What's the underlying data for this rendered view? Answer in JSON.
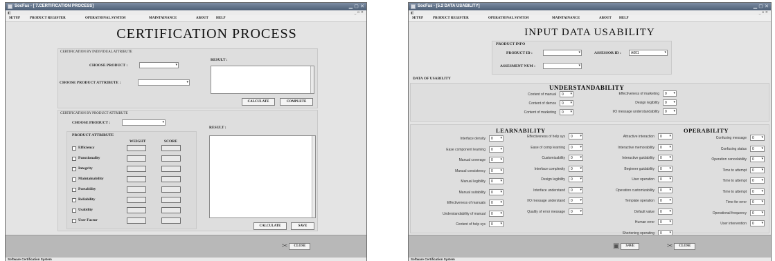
{
  "win1": {
    "title": "SocFas - [ 7.CERTIFICATION PROCESS]",
    "menu": [
      "SETUP",
      "PRODUCT REGISTER",
      "OPERATIONAL SYSTEM",
      "MAINTAINANCE",
      "ABOUT",
      "HELP"
    ],
    "page_title": "CERTIFICATION PROCESS",
    "individual": {
      "header": "CERTIFICATION BY INDIVIDUAL ATTRIBUTE",
      "choose_product_label": "CHOOSE PRODUCT :",
      "choose_attribute_label": "CHOOSE PRODUCT ATTRIBUTE :",
      "result_label": "RESULT :",
      "calculate": "CALCULATE",
      "complete": "COMPLETE"
    },
    "byproduct": {
      "header": "CERTIFICATION BY PRODUCT ATTRIBUTE",
      "choose_product_label": "CHOOSE PRODUCT :",
      "attr_group_label": "PRODUCT ATTRIBUTE",
      "weight_col": "WEIGHT",
      "score_col": "SCORE",
      "attributes": [
        "Efficiency",
        "Functionality",
        "Integrity",
        "Maintainability",
        "Portability",
        "Reliability",
        "Usability",
        "User Factor"
      ],
      "result_label": "RESULT :",
      "calculate": "CALCULATE",
      "save": "SAVE"
    },
    "close": "CLOSE",
    "status": "Software Certification System"
  },
  "win2": {
    "title": "SocFas - [5.2 DATA USABILITY]",
    "menu": [
      "SETUP",
      "PRODUCT REGISTER",
      "OPERATIONAL SYSTEM",
      "MAINTAINANCE",
      "ABOUT",
      "HELP"
    ],
    "page_title": "INPUT DATA USABILITY",
    "product_info": {
      "header": "PRODUCT INFO",
      "product_id_label": "PRODUCT ID :",
      "assessor_id_label": "ASSESSOR ID :",
      "assessor_id_value": "A001",
      "assessment_num_label": "ASSESMENT NUM :"
    },
    "data_of_usability": "DATA OF USABILITY",
    "understandability": {
      "title": "UNDERSTANDABILITY",
      "left": [
        {
          "label": "Content of manual",
          "value": "0"
        },
        {
          "label": "Content of demos",
          "value": "0"
        },
        {
          "label": "Content of marketing",
          "value": "0"
        }
      ],
      "right": [
        {
          "label": "Effectiveness of marketing",
          "value": "0"
        },
        {
          "label": "Design legibility",
          "value": "0"
        },
        {
          "label": "I/O message understandability",
          "value": "0"
        }
      ]
    },
    "learnability": {
      "title": "LEARNABILITY",
      "col1": [
        {
          "label": "Interface density",
          "value": "0"
        },
        {
          "label": "Ease component learning",
          "value": "0"
        },
        {
          "label": "Manual coverage",
          "value": "0"
        },
        {
          "label": "Manual consistency",
          "value": "0"
        },
        {
          "label": "Manual legibility",
          "value": "0"
        },
        {
          "label": "Manual suitability",
          "value": "0"
        },
        {
          "label": "Effectiveness of manuals",
          "value": "0"
        },
        {
          "label": "Understandability of manual",
          "value": "0"
        },
        {
          "label": "Content of help sys",
          "value": "0"
        }
      ],
      "col2": [
        {
          "label": "Effectiveness of help sys",
          "value": "0"
        },
        {
          "label": "Ease of comp learning",
          "value": "0"
        },
        {
          "label": "Customizability",
          "value": "0"
        },
        {
          "label": "Interface complexity",
          "value": "0"
        },
        {
          "label": "Design legibility",
          "value": "0"
        },
        {
          "label": "Interface understand",
          "value": "0"
        },
        {
          "label": "I/O message understand",
          "value": "0"
        },
        {
          "label": "Quality of error message",
          "value": "0"
        }
      ]
    },
    "operability": {
      "title": "OPERABILITY",
      "col1": [
        {
          "label": "Attractive interaction",
          "value": "0"
        },
        {
          "label": "Interactive memorability",
          "value": "0"
        },
        {
          "label": "Interactive guidability",
          "value": "0"
        },
        {
          "label": "Beginner guidability",
          "value": "0"
        },
        {
          "label": "User operation",
          "value": "0"
        },
        {
          "label": "Operation customizability",
          "value": "0"
        },
        {
          "label": "Template operation",
          "value": "0"
        },
        {
          "label": "Default value",
          "value": "0"
        },
        {
          "label": "Human error",
          "value": "0"
        },
        {
          "label": "Shortening operating",
          "value": "0"
        }
      ],
      "col2": [
        {
          "label": "Confusing message",
          "value": "0"
        },
        {
          "label": "Confusing status",
          "value": "0"
        },
        {
          "label": "Operation cancelability",
          "value": "0"
        },
        {
          "label": "Time to attempt",
          "value": "0"
        },
        {
          "label": "Time to attempt",
          "value": "0"
        },
        {
          "label": "Time to attempt",
          "value": "0"
        },
        {
          "label": "Time for error",
          "value": "0"
        },
        {
          "label": "Operational frequency",
          "value": "0"
        },
        {
          "label": "User intervention",
          "value": "0"
        }
      ]
    },
    "save": "SAVE",
    "close": "CLOSE",
    "status": "Software Certification System"
  }
}
